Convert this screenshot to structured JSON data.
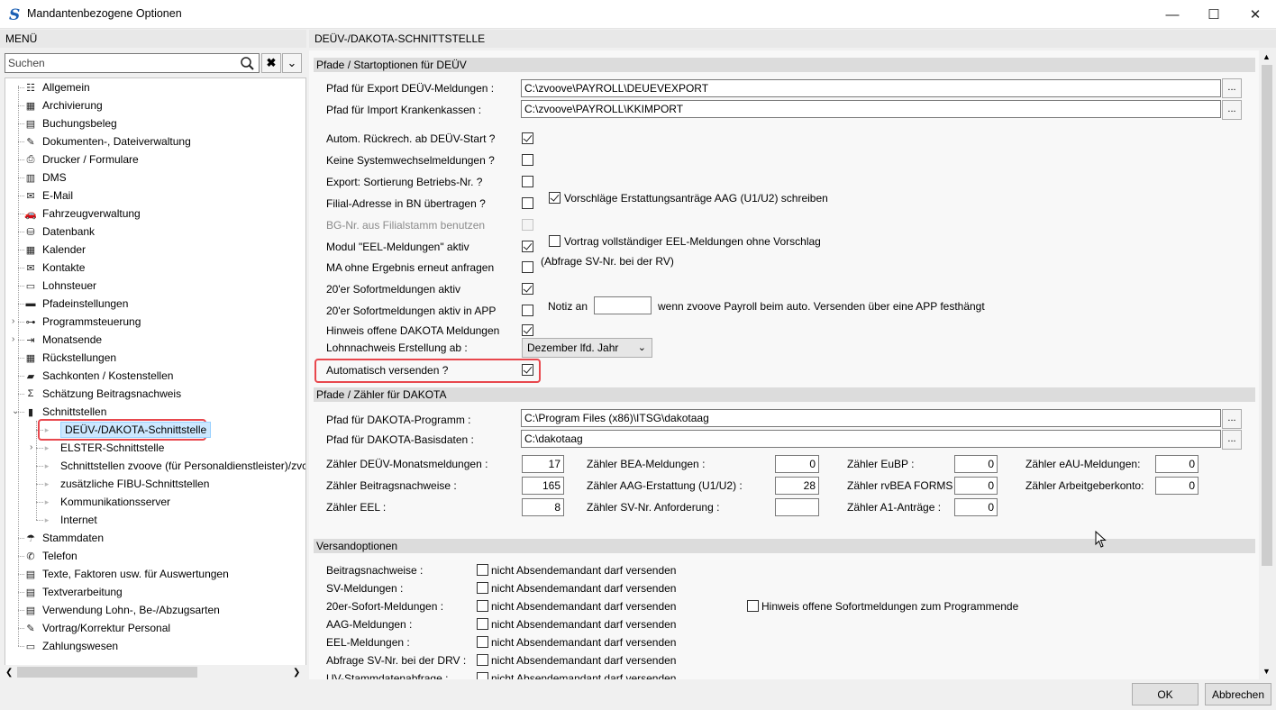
{
  "window": {
    "title": "Mandantenbezogene Optionen"
  },
  "left": {
    "header": "MENÜ",
    "search_placeholder": "Suchen"
  },
  "tree": [
    {
      "label": "Allgemein",
      "icon": "☷",
      "depth": 0
    },
    {
      "label": "Archivierung",
      "icon": "▦",
      "depth": 0
    },
    {
      "label": "Buchungsbeleg",
      "icon": "▤",
      "depth": 0
    },
    {
      "label": "Dokumenten-, Dateiverwaltung",
      "icon": "✎",
      "depth": 0
    },
    {
      "label": "Drucker / Formulare",
      "icon": "⎙",
      "depth": 0
    },
    {
      "label": "DMS",
      "icon": "▥",
      "depth": 0
    },
    {
      "label": "E-Mail",
      "icon": "✉",
      "depth": 0
    },
    {
      "label": "Fahrzeugverwaltung",
      "icon": "🚗",
      "depth": 0
    },
    {
      "label": "Datenbank",
      "icon": "⛁",
      "depth": 0
    },
    {
      "label": "Kalender",
      "icon": "▦",
      "depth": 0
    },
    {
      "label": "Kontakte",
      "icon": "✉",
      "depth": 0
    },
    {
      "label": "Lohnsteuer",
      "icon": "▭",
      "depth": 0
    },
    {
      "label": "Pfadeinstellungen",
      "icon": "▬",
      "depth": 0
    },
    {
      "label": "Programmsteuerung",
      "icon": "⊶",
      "depth": 0,
      "expander": "closed"
    },
    {
      "label": "Monatsende",
      "icon": "⇥",
      "depth": 0,
      "expander": "closed"
    },
    {
      "label": "Rückstellungen",
      "icon": "▦",
      "depth": 0
    },
    {
      "label": "Sachkonten / Kostenstellen",
      "icon": "▰",
      "depth": 0
    },
    {
      "label": "Schätzung Beitragsnachweis",
      "icon": "Σ",
      "depth": 0
    },
    {
      "label": "Schnittstellen",
      "icon": "▮",
      "depth": 0,
      "expander": "open"
    },
    {
      "label": "DEÜV-/DAKOTA-Schnittstelle",
      "icon": "",
      "depth": 1,
      "selected": true
    },
    {
      "label": "ELSTER-Schnittstelle",
      "icon": "",
      "depth": 1,
      "expander": "closed"
    },
    {
      "label": "Schnittstellen zvoove (für Personaldienstleister)/zvc",
      "icon": "",
      "depth": 1
    },
    {
      "label": "zusätzliche FIBU-Schnittstellen",
      "icon": "",
      "depth": 1
    },
    {
      "label": "Kommunikationsserver",
      "icon": "",
      "depth": 1
    },
    {
      "label": "Internet",
      "icon": "",
      "depth": 1
    },
    {
      "label": "Stammdaten",
      "icon": "☂",
      "depth": 0
    },
    {
      "label": "Telefon",
      "icon": "✆",
      "depth": 0
    },
    {
      "label": "Texte, Faktoren usw. für Auswertungen",
      "icon": "▤",
      "depth": 0
    },
    {
      "label": "Textverarbeitung",
      "icon": "▤",
      "depth": 0
    },
    {
      "label": "Verwendung Lohn-, Be-/Abzugsarten",
      "icon": "▤",
      "depth": 0
    },
    {
      "label": "Vortrag/Korrektur Personal",
      "icon": "✎",
      "depth": 0
    },
    {
      "label": "Zahlungswesen",
      "icon": "▭",
      "depth": 0
    }
  ],
  "right": {
    "header": "DEÜV-/DAKOTA-SCHNITTSTELLE"
  },
  "sec1": {
    "title": "Pfade / Startoptionen für DEÜV",
    "export_label": "Pfad für Export DEÜV-Meldungen :",
    "export_value": "C:\\zvoove\\PAYROLL\\DEUEVEXPORT",
    "import_label": "Pfad für Import Krankenkassen :",
    "import_value": "C:\\zvoove\\PAYROLL\\KKIMPORT",
    "dots": "...",
    "rows": [
      {
        "label": "Autom. Rückrech. ab DEÜV-Start ?",
        "checked": true
      },
      {
        "label": "Keine Systemwechselmeldungen ?",
        "checked": false
      },
      {
        "label": "Export: Sortierung Betriebs-Nr. ?",
        "checked": false
      },
      {
        "label": "Filial-Adresse in BN übertragen ?",
        "checked": false
      },
      {
        "label": "BG-Nr. aus Filialstamm benutzen",
        "checked": false,
        "disabled": true
      },
      {
        "label": "Modul \"EEL-Meldungen\" aktiv",
        "checked": true
      },
      {
        "label": "MA ohne Ergebnis erneut anfragen",
        "checked": false
      },
      {
        "label": "20'er Sofortmeldungen aktiv",
        "checked": true
      },
      {
        "label": "20'er Sofortmeldungen aktiv in APP",
        "checked": false
      },
      {
        "label": "Hinweis offene DAKOTA Meldungen",
        "checked": true
      }
    ],
    "vorschlaege": "Vorschläge Erstattungsanträge AAG (U1/U2) schreiben",
    "vortrag": "Vortrag vollständiger EEL-Meldungen ohne Vorschlag",
    "abfrage": "(Abfrage SV-Nr. bei der RV)",
    "notiz": "Notiz an",
    "notiz_value": "",
    "notiz_suffix": "wenn zvoove Payroll beim auto. Versenden über eine APP festhängt",
    "lohnnachweis_label": "Lohnnachweis Erstellung ab :",
    "lohnnachweis_value": "Dezember lfd. Jahr",
    "auto_label": "Automatisch versenden ?"
  },
  "sec2": {
    "title": "Pfade / Zähler für DAKOTA",
    "prog_label": "Pfad für DAKOTA-Programm :",
    "prog_value": "C:\\Program Files (x86)\\ITSG\\dakotaag",
    "basis_label": "Pfad für DAKOTA-Basisdaten :",
    "basis_value": "C:\\dakotaag",
    "c1": [
      {
        "label": "Zähler DEÜV-Monatsmeldungen :",
        "value": "17"
      },
      {
        "label": "Zähler Beitragsnachweise :",
        "value": "165"
      },
      {
        "label": "Zähler EEL :",
        "value": "8"
      }
    ],
    "c2": [
      {
        "label": "Zähler BEA-Meldungen :",
        "value": "0"
      },
      {
        "label": "Zähler AAG-Erstattung (U1/U2) :",
        "value": "28"
      },
      {
        "label": "Zähler SV-Nr. Anforderung :",
        "value": ""
      }
    ],
    "c3": [
      {
        "label": "Zähler EuBP :",
        "value": "0"
      },
      {
        "label": "Zähler rvBEA FORMS :",
        "value": "0"
      },
      {
        "label": "Zähler A1-Anträge :",
        "value": "0"
      }
    ],
    "c4": [
      {
        "label": "Zähler eAU-Meldungen:",
        "value": "0"
      },
      {
        "label": "Zähler Arbeitgeberkonto:",
        "value": "0"
      }
    ]
  },
  "sec3": {
    "title": "Versandoptionen",
    "check_text": "nicht Absendemandant darf versenden",
    "rows": [
      "Beitragsnachweise :",
      "SV-Meldungen :",
      "20er-Sofort-Meldungen :",
      "AAG-Meldungen :",
      "EEL-Meldungen :",
      "Abfrage SV-Nr. bei der DRV :",
      "UV-Stammdatenabfrage :"
    ],
    "hinweis": "Hinweis offene Sofortmeldungen zum Programmende"
  },
  "footer": {
    "ok": "OK",
    "cancel": "Abbrechen"
  }
}
